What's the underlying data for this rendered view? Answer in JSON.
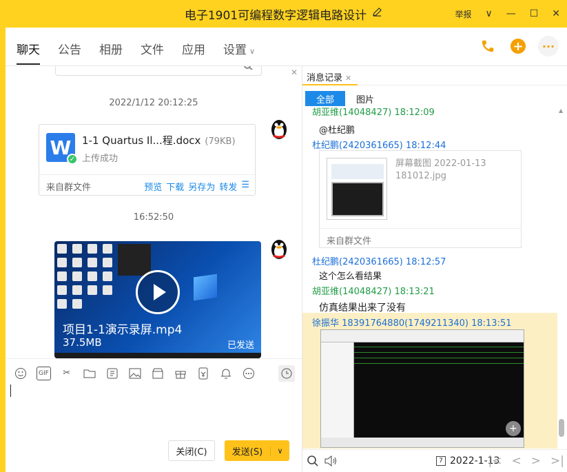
{
  "window": {
    "title": "电子1901可编程数字逻辑电路设计",
    "report_label": "举报",
    "colors": {
      "accent": "#ffd21f",
      "primary_button": "#ffc21a",
      "link": "#1a88e8"
    }
  },
  "tabs": [
    {
      "label": "聊天",
      "active": true
    },
    {
      "label": "公告"
    },
    {
      "label": "相册"
    },
    {
      "label": "文件"
    },
    {
      "label": "应用"
    },
    {
      "label": "设置"
    }
  ],
  "chat": {
    "timestamp1": "2022/1/12 20:12:25",
    "file": {
      "name": "1-1 Quartus Il...程.docx",
      "size": "(79KB)",
      "status": "上传成功",
      "source": "来自群文件",
      "actions": [
        "预览",
        "下载",
        "另存为",
        "转发"
      ]
    },
    "timestamp2": "16:52:50",
    "video": {
      "name": "项目1-1演示录屏.mp4",
      "size": "37.5MB",
      "status": "已发送"
    }
  },
  "composer": {
    "close_label": "关闭(C)",
    "send_label": "发送(S)"
  },
  "history": {
    "panel_title": "消息记录",
    "filters": [
      "全部",
      "图片"
    ],
    "messages": [
      {
        "sender": "胡亚维(14048427) 18:12:09",
        "text": "@杜纪鹏"
      },
      {
        "sender": "杜纪鹏(2420361665) 18:12:44"
      },
      {
        "sender": "杜纪鹏(2420361665) 18:12:57",
        "text": "这个怎么看结果"
      },
      {
        "sender": "胡亚维(14048427) 18:13:21",
        "text": "仿真结果出来了没有"
      },
      {
        "sender": "徐振华 18391764880(1749211340) 18:13:51"
      }
    ],
    "image_card": {
      "name": "屏幕截图 2022-01-13 181012.jpg",
      "source": "来自群文件"
    },
    "date": "2022-1-13",
    "calendar_day": "7"
  }
}
